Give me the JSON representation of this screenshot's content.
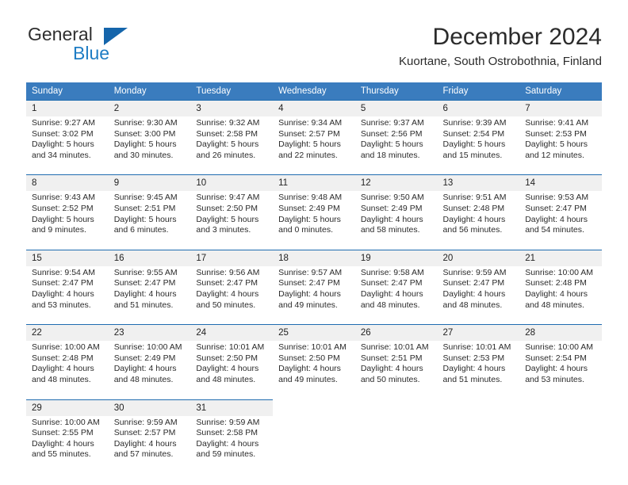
{
  "brand": {
    "name_part1": "General",
    "name_part2": "Blue",
    "logo_icon": "blue-triangle-logo"
  },
  "header": {
    "month_title": "December 2024",
    "location": "Kuortane, South Ostrobothnia, Finland"
  },
  "colors": {
    "header_blue": "#3a7cbe",
    "rule_blue": "#1f6cb0",
    "daynum_band": "#f0f0f0",
    "brand_blue": "#1f7dc4",
    "text": "#2b2b2b"
  },
  "weekday_headers": [
    "Sunday",
    "Monday",
    "Tuesday",
    "Wednesday",
    "Thursday",
    "Friday",
    "Saturday"
  ],
  "weeks": [
    {
      "days": [
        {
          "num": "1",
          "sunrise": "Sunrise: 9:27 AM",
          "sunset": "Sunset: 3:02 PM",
          "daylight1": "Daylight: 5 hours",
          "daylight2": "and 34 minutes."
        },
        {
          "num": "2",
          "sunrise": "Sunrise: 9:30 AM",
          "sunset": "Sunset: 3:00 PM",
          "daylight1": "Daylight: 5 hours",
          "daylight2": "and 30 minutes."
        },
        {
          "num": "3",
          "sunrise": "Sunrise: 9:32 AM",
          "sunset": "Sunset: 2:58 PM",
          "daylight1": "Daylight: 5 hours",
          "daylight2": "and 26 minutes."
        },
        {
          "num": "4",
          "sunrise": "Sunrise: 9:34 AM",
          "sunset": "Sunset: 2:57 PM",
          "daylight1": "Daylight: 5 hours",
          "daylight2": "and 22 minutes."
        },
        {
          "num": "5",
          "sunrise": "Sunrise: 9:37 AM",
          "sunset": "Sunset: 2:56 PM",
          "daylight1": "Daylight: 5 hours",
          "daylight2": "and 18 minutes."
        },
        {
          "num": "6",
          "sunrise": "Sunrise: 9:39 AM",
          "sunset": "Sunset: 2:54 PM",
          "daylight1": "Daylight: 5 hours",
          "daylight2": "and 15 minutes."
        },
        {
          "num": "7",
          "sunrise": "Sunrise: 9:41 AM",
          "sunset": "Sunset: 2:53 PM",
          "daylight1": "Daylight: 5 hours",
          "daylight2": "and 12 minutes."
        }
      ]
    },
    {
      "days": [
        {
          "num": "8",
          "sunrise": "Sunrise: 9:43 AM",
          "sunset": "Sunset: 2:52 PM",
          "daylight1": "Daylight: 5 hours",
          "daylight2": "and 9 minutes."
        },
        {
          "num": "9",
          "sunrise": "Sunrise: 9:45 AM",
          "sunset": "Sunset: 2:51 PM",
          "daylight1": "Daylight: 5 hours",
          "daylight2": "and 6 minutes."
        },
        {
          "num": "10",
          "sunrise": "Sunrise: 9:47 AM",
          "sunset": "Sunset: 2:50 PM",
          "daylight1": "Daylight: 5 hours",
          "daylight2": "and 3 minutes."
        },
        {
          "num": "11",
          "sunrise": "Sunrise: 9:48 AM",
          "sunset": "Sunset: 2:49 PM",
          "daylight1": "Daylight: 5 hours",
          "daylight2": "and 0 minutes."
        },
        {
          "num": "12",
          "sunrise": "Sunrise: 9:50 AM",
          "sunset": "Sunset: 2:49 PM",
          "daylight1": "Daylight: 4 hours",
          "daylight2": "and 58 minutes."
        },
        {
          "num": "13",
          "sunrise": "Sunrise: 9:51 AM",
          "sunset": "Sunset: 2:48 PM",
          "daylight1": "Daylight: 4 hours",
          "daylight2": "and 56 minutes."
        },
        {
          "num": "14",
          "sunrise": "Sunrise: 9:53 AM",
          "sunset": "Sunset: 2:47 PM",
          "daylight1": "Daylight: 4 hours",
          "daylight2": "and 54 minutes."
        }
      ]
    },
    {
      "days": [
        {
          "num": "15",
          "sunrise": "Sunrise: 9:54 AM",
          "sunset": "Sunset: 2:47 PM",
          "daylight1": "Daylight: 4 hours",
          "daylight2": "and 53 minutes."
        },
        {
          "num": "16",
          "sunrise": "Sunrise: 9:55 AM",
          "sunset": "Sunset: 2:47 PM",
          "daylight1": "Daylight: 4 hours",
          "daylight2": "and 51 minutes."
        },
        {
          "num": "17",
          "sunrise": "Sunrise: 9:56 AM",
          "sunset": "Sunset: 2:47 PM",
          "daylight1": "Daylight: 4 hours",
          "daylight2": "and 50 minutes."
        },
        {
          "num": "18",
          "sunrise": "Sunrise: 9:57 AM",
          "sunset": "Sunset: 2:47 PM",
          "daylight1": "Daylight: 4 hours",
          "daylight2": "and 49 minutes."
        },
        {
          "num": "19",
          "sunrise": "Sunrise: 9:58 AM",
          "sunset": "Sunset: 2:47 PM",
          "daylight1": "Daylight: 4 hours",
          "daylight2": "and 48 minutes."
        },
        {
          "num": "20",
          "sunrise": "Sunrise: 9:59 AM",
          "sunset": "Sunset: 2:47 PM",
          "daylight1": "Daylight: 4 hours",
          "daylight2": "and 48 minutes."
        },
        {
          "num": "21",
          "sunrise": "Sunrise: 10:00 AM",
          "sunset": "Sunset: 2:48 PM",
          "daylight1": "Daylight: 4 hours",
          "daylight2": "and 48 minutes."
        }
      ]
    },
    {
      "days": [
        {
          "num": "22",
          "sunrise": "Sunrise: 10:00 AM",
          "sunset": "Sunset: 2:48 PM",
          "daylight1": "Daylight: 4 hours",
          "daylight2": "and 48 minutes."
        },
        {
          "num": "23",
          "sunrise": "Sunrise: 10:00 AM",
          "sunset": "Sunset: 2:49 PM",
          "daylight1": "Daylight: 4 hours",
          "daylight2": "and 48 minutes."
        },
        {
          "num": "24",
          "sunrise": "Sunrise: 10:01 AM",
          "sunset": "Sunset: 2:50 PM",
          "daylight1": "Daylight: 4 hours",
          "daylight2": "and 48 minutes."
        },
        {
          "num": "25",
          "sunrise": "Sunrise: 10:01 AM",
          "sunset": "Sunset: 2:50 PM",
          "daylight1": "Daylight: 4 hours",
          "daylight2": "and 49 minutes."
        },
        {
          "num": "26",
          "sunrise": "Sunrise: 10:01 AM",
          "sunset": "Sunset: 2:51 PM",
          "daylight1": "Daylight: 4 hours",
          "daylight2": "and 50 minutes."
        },
        {
          "num": "27",
          "sunrise": "Sunrise: 10:01 AM",
          "sunset": "Sunset: 2:53 PM",
          "daylight1": "Daylight: 4 hours",
          "daylight2": "and 51 minutes."
        },
        {
          "num": "28",
          "sunrise": "Sunrise: 10:00 AM",
          "sunset": "Sunset: 2:54 PM",
          "daylight1": "Daylight: 4 hours",
          "daylight2": "and 53 minutes."
        }
      ]
    },
    {
      "days": [
        {
          "num": "29",
          "sunrise": "Sunrise: 10:00 AM",
          "sunset": "Sunset: 2:55 PM",
          "daylight1": "Daylight: 4 hours",
          "daylight2": "and 55 minutes."
        },
        {
          "num": "30",
          "sunrise": "Sunrise: 9:59 AM",
          "sunset": "Sunset: 2:57 PM",
          "daylight1": "Daylight: 4 hours",
          "daylight2": "and 57 minutes."
        },
        {
          "num": "31",
          "sunrise": "Sunrise: 9:59 AM",
          "sunset": "Sunset: 2:58 PM",
          "daylight1": "Daylight: 4 hours",
          "daylight2": "and 59 minutes."
        },
        {
          "num": "",
          "sunrise": "",
          "sunset": "",
          "daylight1": "",
          "daylight2": "",
          "empty": true
        },
        {
          "num": "",
          "sunrise": "",
          "sunset": "",
          "daylight1": "",
          "daylight2": "",
          "empty": true
        },
        {
          "num": "",
          "sunrise": "",
          "sunset": "",
          "daylight1": "",
          "daylight2": "",
          "empty": true
        },
        {
          "num": "",
          "sunrise": "",
          "sunset": "",
          "daylight1": "",
          "daylight2": "",
          "empty": true
        }
      ]
    }
  ]
}
